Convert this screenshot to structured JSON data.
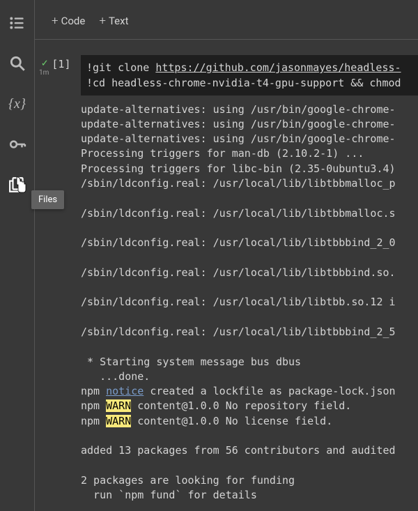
{
  "toolbar": {
    "code_label": "Code",
    "text_label": "Text"
  },
  "cell": {
    "index_label": "[1]",
    "checkmark": "✓",
    "duration": "1m",
    "code_line1_prefix": "!git clone ",
    "code_line1_url": "https://github.com/jasonmayes/headless-",
    "code_line2": "!cd headless-chrome-nvidia-t4-gpu-support && chmod"
  },
  "output": {
    "lines": [
      {
        "text": "update-alternatives: using /usr/bin/google-chrome-"
      },
      {
        "text": "update-alternatives: using /usr/bin/google-chrome-"
      },
      {
        "text": "update-alternatives: using /usr/bin/google-chrome-"
      },
      {
        "text": "Processing triggers for man-db (2.10.2-1) ..."
      },
      {
        "text": "Processing triggers for libc-bin (2.35-0ubuntu3.4)"
      },
      {
        "text": "/sbin/ldconfig.real: /usr/local/lib/libtbbmalloc_p"
      },
      {
        "blank": true
      },
      {
        "text": "/sbin/ldconfig.real: /usr/local/lib/libtbbmalloc.s"
      },
      {
        "blank": true
      },
      {
        "text": "/sbin/ldconfig.real: /usr/local/lib/libtbbbind_2_0"
      },
      {
        "blank": true
      },
      {
        "text": "/sbin/ldconfig.real: /usr/local/lib/libtbbbind.so."
      },
      {
        "blank": true
      },
      {
        "text": "/sbin/ldconfig.real: /usr/local/lib/libtbb.so.12 i"
      },
      {
        "blank": true
      },
      {
        "text": "/sbin/ldconfig.real: /usr/local/lib/libtbbbind_2_5"
      },
      {
        "blank": true
      },
      {
        "text": " * Starting system message bus dbus"
      },
      {
        "text": "   ...done."
      },
      {
        "parts": [
          {
            "t": "npm "
          },
          {
            "t": "notice",
            "cls": "notice"
          },
          {
            "t": " created a lockfile as package-lock.json"
          }
        ]
      },
      {
        "parts": [
          {
            "t": "npm "
          },
          {
            "t": "WARN",
            "cls": "warn"
          },
          {
            "t": " content@1.0.0 No repository field."
          }
        ]
      },
      {
        "parts": [
          {
            "t": "npm "
          },
          {
            "t": "WARN",
            "cls": "warn"
          },
          {
            "t": " content@1.0.0 No license field."
          }
        ]
      },
      {
        "blank": true
      },
      {
        "text": "added 13 packages from 56 contributors and audited"
      },
      {
        "blank": true
      },
      {
        "text": "2 packages are looking for funding"
      },
      {
        "text": "  run `npm fund` for details"
      }
    ]
  },
  "tooltip": {
    "text": "Files"
  },
  "sidebar_icons": {
    "toc": "toc-icon",
    "search": "search-icon",
    "vars": "variables-icon",
    "secrets": "key-icon",
    "files": "files-icon"
  }
}
